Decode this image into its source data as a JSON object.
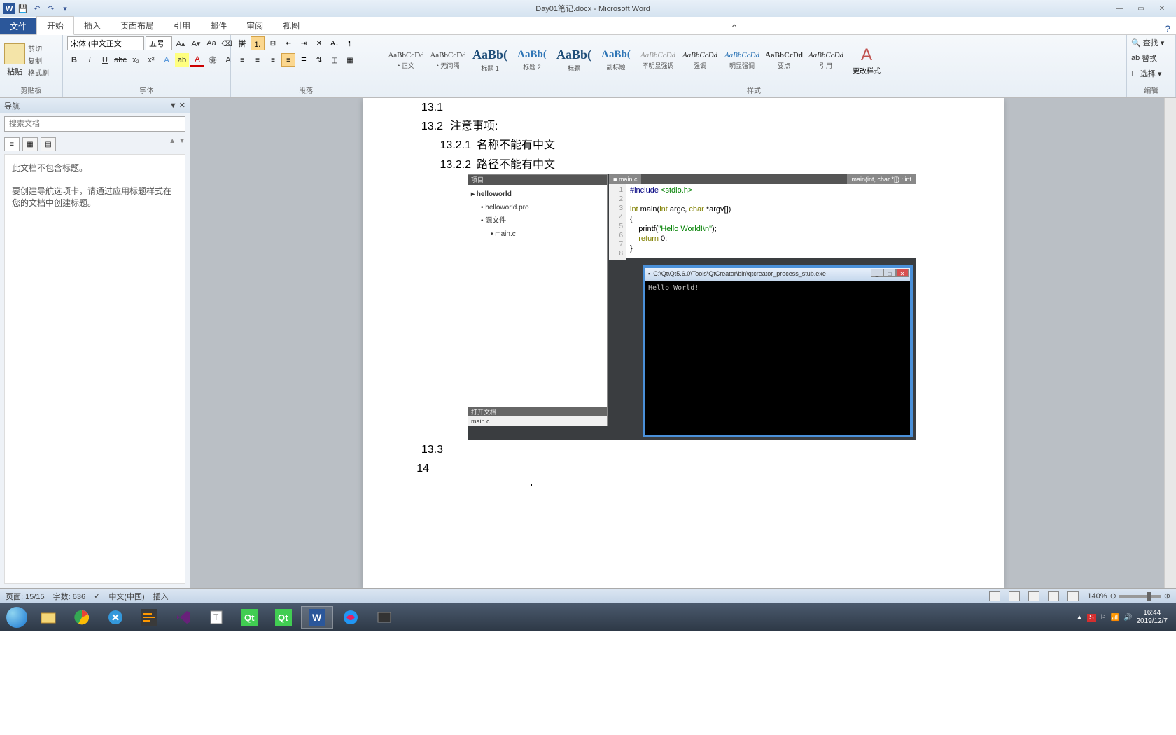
{
  "titlebar": {
    "title": "Day01笔记.docx - Microsoft Word"
  },
  "ribbon_tabs": {
    "file": "文件",
    "home": "开始",
    "insert": "插入",
    "layout": "页面布局",
    "references": "引用",
    "mailings": "邮件",
    "review": "审阅",
    "view": "视图"
  },
  "ribbon": {
    "clipboard": {
      "paste": "粘贴",
      "cut": "剪切",
      "copy": "复制",
      "format_painter": "格式刷",
      "label": "剪贴板"
    },
    "font": {
      "name": "宋体 (中文正文",
      "size": "五号",
      "label": "字体"
    },
    "paragraph": {
      "label": "段落"
    },
    "styles": {
      "label": "样式",
      "items": [
        {
          "preview": "AaBbCcDd",
          "label": "• 正文",
          "cls": "normal"
        },
        {
          "preview": "AaBbCcDd",
          "label": "• 无间隔",
          "cls": "normal"
        },
        {
          "preview": "AaBb(",
          "label": "标题 1",
          "cls": "h1"
        },
        {
          "preview": "AaBb(",
          "label": "标题 2",
          "cls": "h2"
        },
        {
          "preview": "AaBb(",
          "label": "标题",
          "cls": "h1"
        },
        {
          "preview": "AaBb(",
          "label": "副标题",
          "cls": "h2"
        },
        {
          "preview": "AaBbCcDd",
          "label": "不明显强调",
          "cls": "subtle"
        },
        {
          "preview": "AaBbCcDd",
          "label": "强调",
          "cls": "emphasis"
        },
        {
          "preview": "AaBbCcDd",
          "label": "明显强调",
          "cls": "intense"
        },
        {
          "preview": "AaBbCcDd",
          "label": "要点",
          "cls": "strong"
        },
        {
          "preview": "AaBbCcDd",
          "label": "引用",
          "cls": "quote"
        }
      ],
      "change_styles": "更改样式"
    },
    "editing": {
      "find": "查找",
      "replace": "替换",
      "select": "选择",
      "label": "编辑"
    }
  },
  "nav": {
    "title": "导航",
    "search_placeholder": "搜索文档",
    "no_headings": "此文档不包含标题。",
    "hint": "要创建导航选项卡，请通过应用标题样式在您的文档中创建标题。"
  },
  "document": {
    "lines": [
      {
        "num": "13.1",
        "text": ""
      },
      {
        "num": "13.2",
        "text": "注意事项:"
      },
      {
        "num": "13.2.1",
        "text": "名称不能有中文",
        "sub": true
      },
      {
        "num": "13.2.2",
        "text": "路径不能有中文",
        "sub": true
      }
    ],
    "after_num1": "13.3",
    "after_num2": "14"
  },
  "ide": {
    "project_header": "项目",
    "tree": [
      {
        "text": "helloworld",
        "cls": "bold"
      },
      {
        "text": "helloworld.pro",
        "cls": "indent1"
      },
      {
        "text": "源文件",
        "cls": "indent1"
      },
      {
        "text": "main.c",
        "cls": "indent2"
      }
    ],
    "open_docs": "打开文档",
    "open_file": "main.c",
    "tab": "main.c",
    "func_sig": "main(int, char *[]) : int",
    "code_lines": [
      "1",
      "2",
      "3",
      "4",
      "5",
      "6",
      "7",
      "8"
    ],
    "code": {
      "l1_a": "#include ",
      "l1_b": "<stdio.h>",
      "l3_a": "int",
      "l3_b": " main(",
      "l3_c": "int",
      "l3_d": " argc, ",
      "l3_e": "char",
      "l3_f": " *argv[])",
      "l4": "{",
      "l5_a": "    printf(",
      "l5_b": "\"Hello World!\\n\"",
      "l5_c": ");",
      "l6_a": "    ",
      "l6_b": "return",
      "l6_c": " 0;",
      "l7": "}"
    },
    "console_title": "C:\\Qt\\Qt5.6.0\\Tools\\QtCreator\\bin\\qtcreator_process_stub.exe",
    "console_out": "Hello World!"
  },
  "statusbar": {
    "page": "页面: 15/15",
    "words": "字数: 636",
    "lang": "中文(中国)",
    "mode": "插入",
    "zoom": "140%"
  },
  "tray": {
    "time": "16:44",
    "date": "2019/12/7"
  }
}
